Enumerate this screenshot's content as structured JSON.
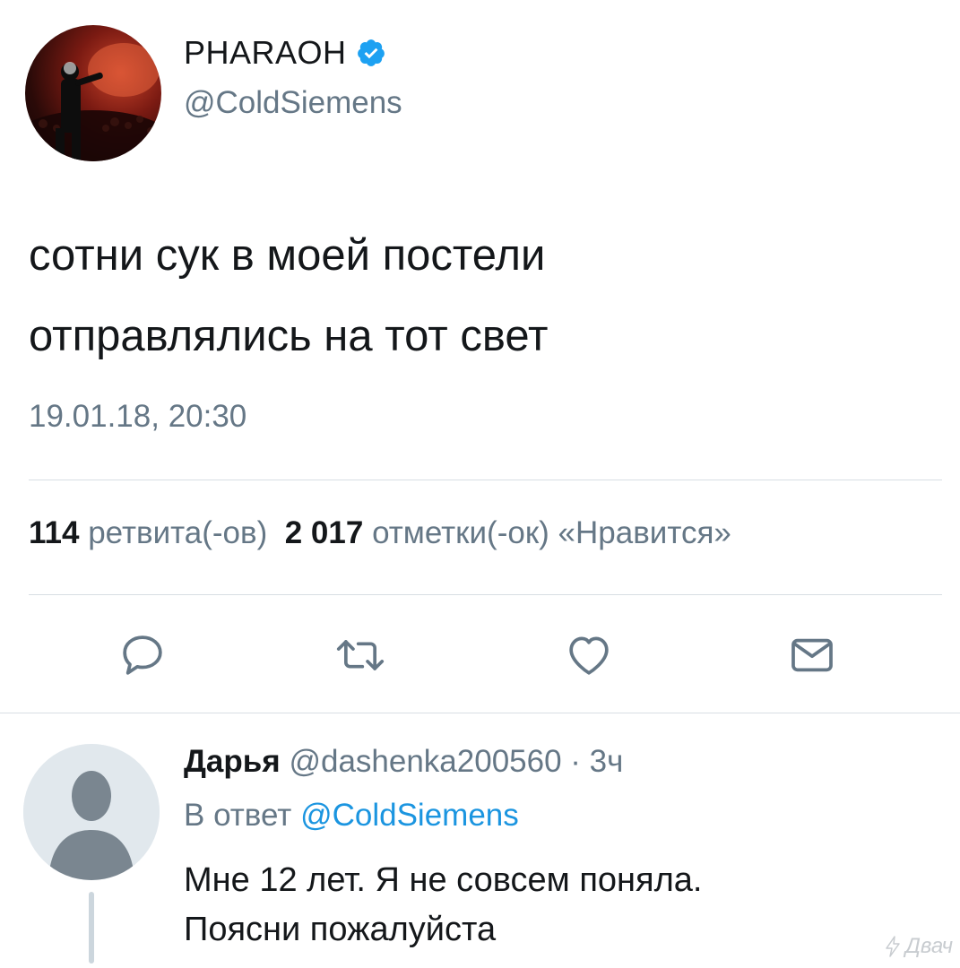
{
  "author": {
    "display_name": "PHARAOH",
    "handle": "@ColdSiemens",
    "verified": true,
    "avatar_icon": "concert-photo-avatar"
  },
  "tweet": {
    "lines": [
      "сотни сук в моей постели",
      "отправлялись на тот свет"
    ],
    "timestamp": "19.01.18, 20:30",
    "stats": {
      "retweets_count": "114",
      "retweets_label": "ретвита(-ов)",
      "likes_count": "2 017",
      "likes_label": "отметки(-ок) «Нравится»"
    }
  },
  "actions": [
    {
      "icon": "reply-icon"
    },
    {
      "icon": "retweet-icon"
    },
    {
      "icon": "like-icon"
    },
    {
      "icon": "direct-message-icon"
    }
  ],
  "reply": {
    "name": "Дарья",
    "handle_time": "@dashenka200560 · 3ч",
    "reply_to_prefix": "В ответ",
    "reply_to_mention": "@ColdSiemens",
    "lines": [
      "Мне 12 лет.  Я не совсем поняла.",
      "Поясни пожалуйста"
    ],
    "avatar_icon": "default-user-avatar"
  },
  "watermark": {
    "text": "Двач"
  },
  "colors": {
    "link": "#1b95e0",
    "secondary_text": "#657786",
    "primary_text": "#14171a",
    "verified": "#1da1f2"
  }
}
